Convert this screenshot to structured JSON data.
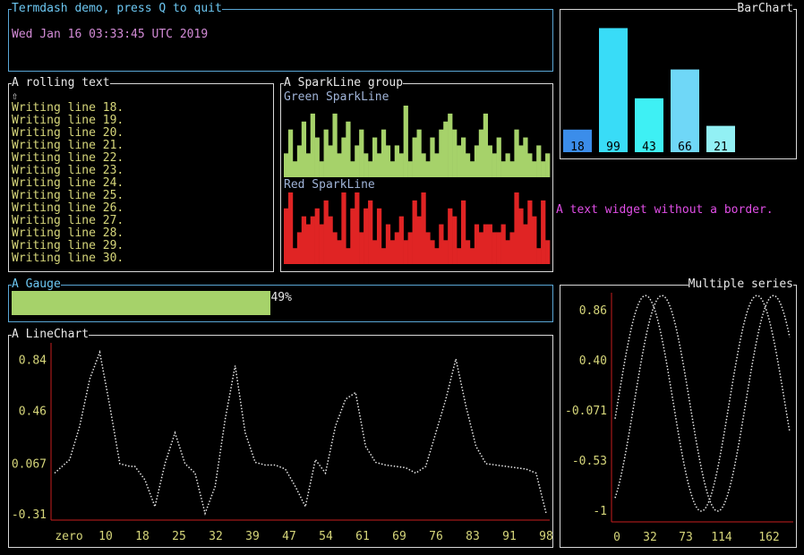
{
  "colors": {
    "blue_border": "#5aa7d6",
    "white_border": "#d8d8d8",
    "cyan_text": "#6cc7f2",
    "magenta": "#e04ee6",
    "pink_text": "#d38bd6",
    "yellow": "#d6d67a",
    "green": "#a6d26a",
    "red": "#e02424",
    "axis_red": "#c81e1e",
    "bar_blue": "#3b8dea",
    "bar_cyan1": "#39dcf7",
    "bar_cyan2": "#3ef0f4",
    "bar_cyan3": "#6fd7f7",
    "bar_cyan4": "#92f0f4"
  },
  "header": {
    "title": "Termdash demo, press Q to quit",
    "time": "Wed Jan 16 03:33:45 UTC 2019"
  },
  "rolling": {
    "title": "A rolling text",
    "scroll_glyph": "⇧",
    "lines": [
      "Writing line 18.",
      "Writing line 19.",
      "Writing line 20.",
      "Writing line 21.",
      "Writing line 22.",
      "Writing line 23.",
      "Writing line 24.",
      "Writing line 25.",
      "Writing line 26.",
      "Writing line 27.",
      "Writing line 28.",
      "Writing line 29.",
      "Writing line 30."
    ]
  },
  "sparks": {
    "title": "A SparkLine group",
    "green_label": "Green SparkLine",
    "red_label": "Red SparkLine",
    "green_values": [
      3,
      6,
      2,
      4,
      7,
      3,
      8,
      5,
      2,
      6,
      4,
      8,
      3,
      5,
      7,
      2,
      4,
      6,
      3,
      2,
      5,
      3,
      6,
      4,
      2,
      4,
      3,
      9,
      2,
      5,
      6,
      3,
      2,
      5,
      3,
      6,
      7,
      8,
      6,
      4,
      5,
      3,
      2,
      4,
      6,
      8,
      4,
      3,
      5,
      2,
      3,
      2,
      6,
      4,
      5,
      3,
      2,
      4,
      2,
      3
    ],
    "red_values": [
      7,
      9,
      2,
      4,
      6,
      5,
      6,
      7,
      5,
      8,
      6,
      4,
      3,
      9,
      2,
      7,
      9,
      4,
      7,
      8,
      3,
      7,
      2,
      5,
      3,
      4,
      6,
      3,
      4,
      8,
      6,
      9,
      4,
      3,
      2,
      5,
      3,
      7,
      6,
      2,
      8,
      3,
      2,
      5,
      4,
      5,
      5,
      4,
      4,
      5,
      3,
      4,
      9,
      7,
      5,
      8,
      6,
      2,
      8,
      3
    ]
  },
  "barchart": {
    "title": "BarChart",
    "values": [
      18,
      99,
      43,
      66,
      21
    ],
    "max": 100
  },
  "text_widget": "A text widget without a border.",
  "gauge": {
    "title": "A Gauge",
    "percent": 49,
    "label": "49%"
  },
  "linechart": {
    "title": "A LineChart",
    "y_ticks": [
      "0.84",
      "0.46",
      "0.067",
      "-0.31"
    ],
    "x_ticks": [
      "zero",
      "10",
      "18",
      "25",
      "32",
      "39",
      "47",
      "54",
      "61",
      "69",
      "76",
      "83",
      "91",
      "98"
    ]
  },
  "multi": {
    "title": "Multiple series",
    "y_ticks": [
      "0.86",
      "0.40",
      "-0.071",
      "-0.53",
      "-1"
    ],
    "x_ticks": [
      "0",
      "32",
      "73",
      "114",
      "162"
    ]
  },
  "chart_data": [
    {
      "type": "line",
      "title": "A LineChart",
      "ylim": [
        -0.35,
        0.97
      ],
      "x_range": [
        0,
        98
      ],
      "series": [
        {
          "x": [
            0,
            3,
            5,
            7,
            9,
            11,
            13,
            15,
            16,
            18,
            20,
            22,
            24,
            26,
            28,
            30,
            32,
            34,
            36,
            38,
            40,
            42,
            44,
            46,
            48,
            50,
            52,
            54,
            56,
            58,
            60,
            62,
            64,
            66,
            68,
            70,
            72,
            74,
            76,
            78,
            80,
            82,
            84,
            86,
            88,
            90,
            92,
            94,
            96,
            98
          ],
          "values": [
            0.0,
            0.1,
            0.35,
            0.7,
            0.9,
            0.5,
            0.07,
            0.05,
            0.05,
            -0.05,
            -0.25,
            0.07,
            0.3,
            0.07,
            0.0,
            -0.3,
            -0.1,
            0.4,
            0.8,
            0.3,
            0.08,
            0.06,
            0.06,
            0.03,
            -0.1,
            -0.25,
            0.1,
            0.0,
            0.35,
            0.55,
            0.6,
            0.2,
            0.08,
            0.06,
            0.05,
            0.04,
            0.0,
            0.05,
            0.3,
            0.55,
            0.85,
            0.5,
            0.2,
            0.07,
            0.06,
            0.05,
            0.04,
            0.03,
            0.0,
            -0.3
          ]
        }
      ]
    },
    {
      "type": "line",
      "title": "Multiple series",
      "ylim": [
        -1,
        1
      ],
      "x_range": [
        0,
        180
      ],
      "series": [
        {
          "x_start": 0,
          "x_end": 180,
          "period": 115,
          "phase": 0,
          "amplitude": 1,
          "kind": "sine"
        },
        {
          "x_start": 0,
          "x_end": 180,
          "period": 115,
          "phase": 0,
          "amplitude": 1,
          "kind": "cosine"
        }
      ]
    }
  ]
}
